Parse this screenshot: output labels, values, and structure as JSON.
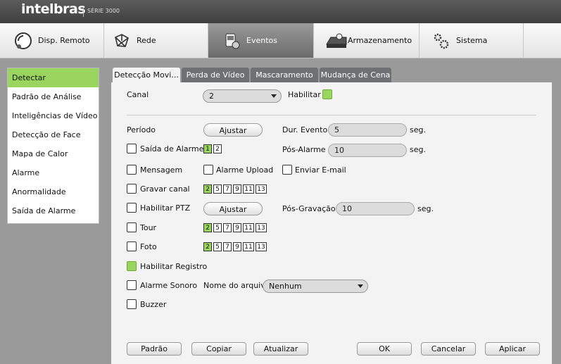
{
  "brand": {
    "logo": "intelbras",
    "series": "SÉRIE 3000"
  },
  "topnav": [
    {
      "label": "Disp. Remoto",
      "icon": "remote-device-icon"
    },
    {
      "label": "Rede",
      "icon": "network-icon"
    },
    {
      "label": "Eventos",
      "icon": "events-icon",
      "active": true
    },
    {
      "label": "Armazenamento",
      "icon": "storage-icon"
    },
    {
      "label": "Sistema",
      "icon": "system-gears-icon"
    }
  ],
  "sidebar": {
    "items": [
      {
        "label": "Detectar",
        "active": true
      },
      {
        "label": "Padrão de Análise"
      },
      {
        "label": "Inteligências de Vídeo"
      },
      {
        "label": "Detecção de Face"
      },
      {
        "label": "Mapa de Calor"
      },
      {
        "label": "Alarme"
      },
      {
        "label": "Anormalidade"
      },
      {
        "label": "Saída de Alarme"
      }
    ]
  },
  "subtabs": [
    {
      "label": "Detecção Movi...",
      "active": true
    },
    {
      "label": "Perda de Vídeo"
    },
    {
      "label": "Mascaramento"
    },
    {
      "label": "Mudança de Cena"
    }
  ],
  "form": {
    "canal_label": "Canal",
    "canal_value": "2",
    "habilitar_label": "Habilitar",
    "periodo_label": "Período",
    "ajustar_label": "Ajustar",
    "dur_evento_label": "Dur. Evento",
    "dur_evento_value": "5",
    "seg": "seg.",
    "saida_alarme_label": "Saída de Alarme",
    "saida_nums": [
      "1",
      "2"
    ],
    "pos_alarme_label": "Pós-Alarme",
    "pos_alarme_value": "10",
    "mensagem_label": "Mensagem",
    "alarme_upload_label": "Alarme Upload",
    "enviar_email_label": "Enviar E-mail",
    "gravar_canal_label": "Gravar canal",
    "channel_nums": [
      "2",
      "5",
      "7",
      "9",
      "11",
      "13"
    ],
    "habilitar_ptz_label": "Habilitar PTZ",
    "pos_gravacao_label": "Pós-Gravação",
    "pos_gravacao_value": "10",
    "tour_label": "Tour",
    "foto_label": "Foto",
    "habilitar_registro_label": "Habilitar Registro",
    "alarme_sonoro_label": "Alarme Sonoro",
    "nome_arquivo_label": "Nome do arquivo",
    "nome_arquivo_value": "Nenhum",
    "buzzer_label": "Buzzer"
  },
  "buttons": {
    "padrao": "Padrão",
    "copiar": "Copiar",
    "atualizar": "Atualizar",
    "ok": "OK",
    "cancelar": "Cancelar",
    "aplicar": "Aplicar"
  },
  "colors": {
    "accent": "#9ad65f",
    "tab_inactive": "#6e7074",
    "header": "#4a4a4a"
  }
}
